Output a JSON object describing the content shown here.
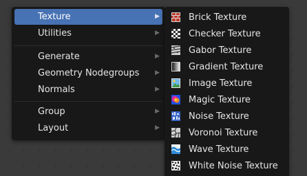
{
  "main_menu": {
    "items": [
      {
        "label": "Texture"
      },
      {
        "label": "Utilities"
      },
      {
        "label": "Generate"
      },
      {
        "label": "Geometry Nodegroups"
      },
      {
        "label": "Normals"
      },
      {
        "label": "Group"
      },
      {
        "label": "Layout"
      }
    ],
    "submenu_arrow": "▶"
  },
  "texture_submenu": {
    "items": [
      {
        "label": "Brick Texture",
        "icon": "brick-icon"
      },
      {
        "label": "Checker Texture",
        "icon": "checker-icon"
      },
      {
        "label": "Gabor Texture",
        "icon": "gabor-icon"
      },
      {
        "label": "Gradient Texture",
        "icon": "gradient-icon"
      },
      {
        "label": "Image Texture",
        "icon": "image-icon"
      },
      {
        "label": "Magic Texture",
        "icon": "magic-icon"
      },
      {
        "label": "Noise Texture",
        "icon": "noise-icon"
      },
      {
        "label": "Voronoi Texture",
        "icon": "voronoi-icon"
      },
      {
        "label": "Wave Texture",
        "icon": "wave-icon"
      },
      {
        "label": "White Noise Texture",
        "icon": "white-noise-icon"
      }
    ]
  },
  "colors": {
    "menu_bg": "#181818",
    "highlight": "#4772b3",
    "text": "#e6e6e6",
    "canvas_bg": "#3a3a3a"
  }
}
